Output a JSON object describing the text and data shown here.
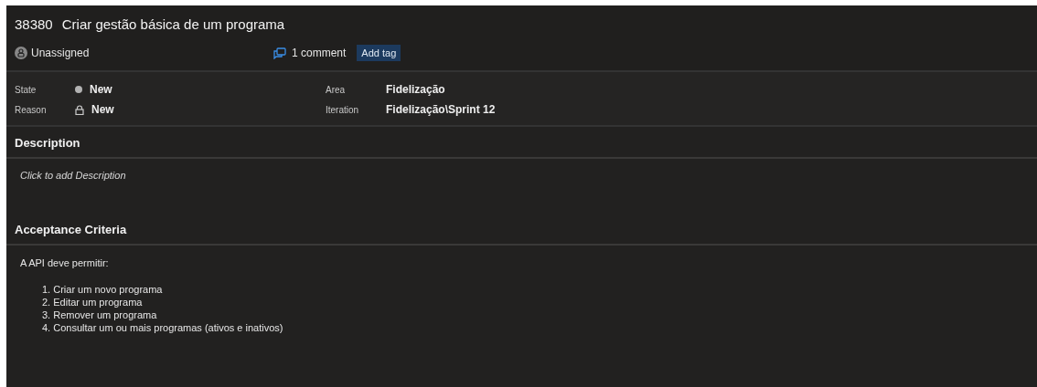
{
  "work_item": {
    "id": "38380",
    "title": "Criar gestão básica de um programa"
  },
  "assignee": {
    "label": "Unassigned"
  },
  "comments": {
    "label": "1 comment"
  },
  "add_tag": {
    "label": "Add tag"
  },
  "fields": [
    {
      "label": "State",
      "value": "New",
      "kind": "state"
    },
    {
      "label": "Area",
      "value": "Fidelização",
      "kind": "plain"
    },
    {
      "label": "Reason",
      "value": "New",
      "kind": "reason"
    },
    {
      "label": "Iteration",
      "value": "Fidelização\\Sprint 12",
      "kind": "plain"
    }
  ],
  "sections": [
    {
      "title": "Description",
      "placeholder": "Click to add Description"
    },
    {
      "title": "Acceptance Criteria",
      "intro": "A API deve permitir:",
      "items": [
        "1. Criar um novo programa",
        "2. Editar um programa",
        "3. Remover um programa",
        "4. Consultar um ou mais programas (ativos e inativos)"
      ]
    }
  ]
}
